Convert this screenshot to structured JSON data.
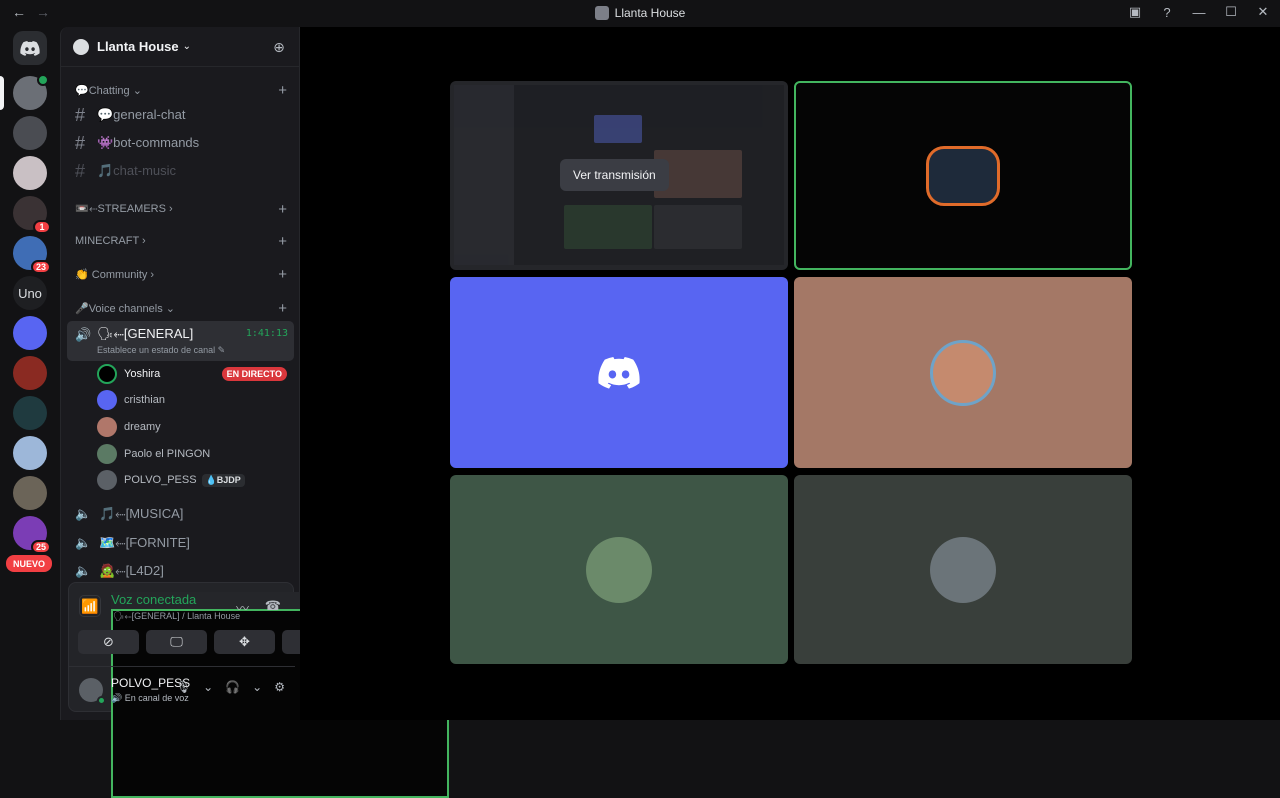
{
  "window": {
    "title": "Llanta House",
    "back_icon": "←",
    "forward_icon": "→",
    "minimize": "—",
    "maximize": "☐",
    "close": "✕"
  },
  "guild_badges": {
    "g1": "",
    "g4": "1",
    "g5": "23",
    "g11": "25",
    "uno": "Uno",
    "nuevo": "NUEVO"
  },
  "server": {
    "name": "Llanta House",
    "chevron": "⌄"
  },
  "categories": [
    {
      "label": "💬Chatting ⌄"
    },
    {
      "label": "📼⬸STREAMERS ›"
    },
    {
      "label": "MINECRAFT ›"
    },
    {
      "label": "👏 Community ›"
    },
    {
      "label": "🎤Voice channels ⌄"
    }
  ],
  "text_channels": [
    {
      "label": "💬general-chat"
    },
    {
      "label": "👾bot-commands"
    },
    {
      "label": "🎵chat-music"
    }
  ],
  "active_voice": {
    "name": "🗣⬸[GENERAL]",
    "time": "1:41:13",
    "status": "Establece un estado de canal ✎"
  },
  "voice_users": [
    {
      "name": "Yoshira",
      "live": "EN DIRECTO"
    },
    {
      "name": "cristhian"
    },
    {
      "name": "dreamy"
    },
    {
      "name": "Paolo el PINGON"
    },
    {
      "name": "POLVO_PESS",
      "tag": "💧BJDP"
    }
  ],
  "voice_channels": [
    {
      "name": "🎵⬸[MUSICA]"
    },
    {
      "name": "🗺️⬸[FORNITE]"
    },
    {
      "name": "🧟⬸[L4D2]"
    }
  ],
  "voice_panel": {
    "title": "Voz conectada",
    "subtitle": "🗣⬸[GENERAL] / Llanta House"
  },
  "user": {
    "name": "POLVO_PESS",
    "status": "🔊 En canal de voz"
  },
  "stage": {
    "watch_label": "Ver transmisión"
  },
  "colors": {
    "accent": "#5865f2",
    "online": "#23a55a",
    "live": "#da373c",
    "speaking_border": "#43b55f"
  }
}
